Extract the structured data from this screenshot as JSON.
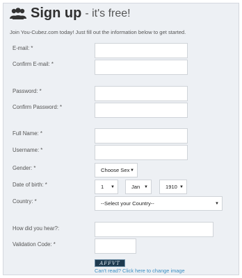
{
  "header": {
    "title": "Sign up",
    "subtitle": "- it's free!",
    "icon": "users-icon"
  },
  "intro": "Join You-Cubez.com today! Just fill out the information below to get started.",
  "form": {
    "email_label": "E-mail: *",
    "confirm_email_label": "Confirm E-mail: *",
    "password_label": "Password: *",
    "confirm_password_label": "Confirm Password: *",
    "full_name_label": "Full Name: *",
    "username_label": "Username: *",
    "gender_label": "Gender: *",
    "gender_value": "Choose Sex",
    "dob_label": "Date of birth: *",
    "dob_day": "1",
    "dob_month": "Jan",
    "dob_year": "1910",
    "country_label": "Country: *",
    "country_value": "--Select your Country--",
    "heard_label": "How did you hear?:",
    "validation_label": "Validation Code: *",
    "captcha_text": "AFFVT",
    "reload_link": "Can't read? Click here to change image"
  }
}
